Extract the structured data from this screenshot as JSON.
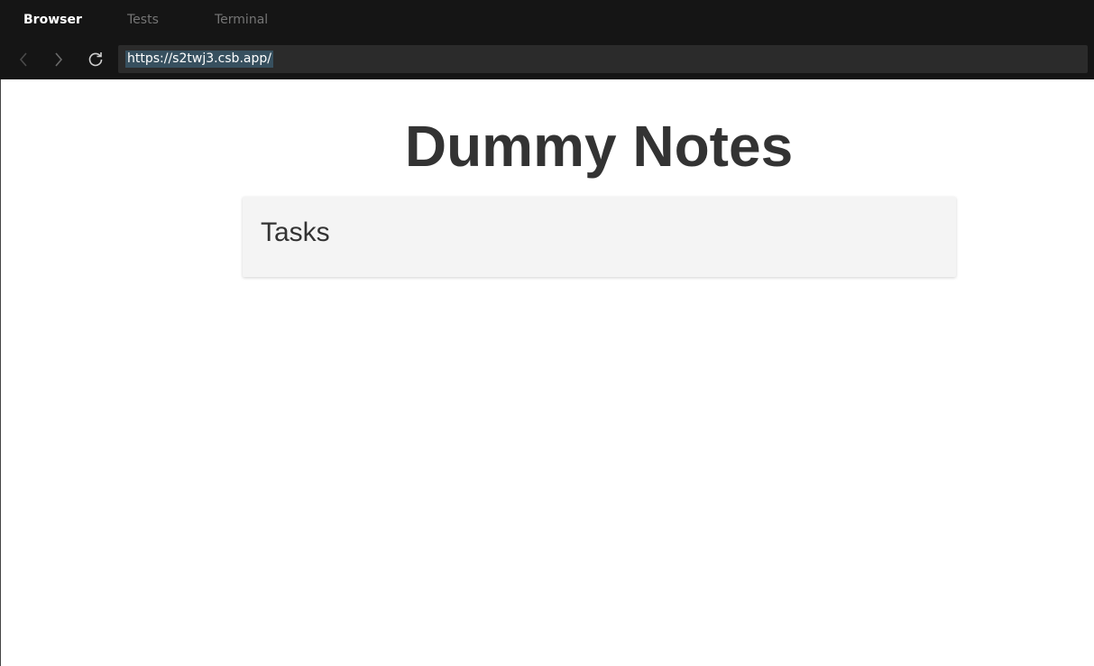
{
  "tabs": [
    {
      "label": "Browser",
      "active": true
    },
    {
      "label": "Tests",
      "active": false
    },
    {
      "label": "Terminal",
      "active": false
    }
  ],
  "nav": {
    "back_icon": "chevron-left-icon",
    "forward_icon": "chevron-right-icon",
    "refresh_icon": "refresh-icon"
  },
  "address_bar": {
    "url": "https://s2twj3.csb.app/"
  },
  "page": {
    "title": "Dummy Notes",
    "card": {
      "title": "Tasks"
    }
  },
  "colors": {
    "chrome_background": "#151515",
    "url_field_background": "#2b2b2b",
    "url_selection": "#37505f",
    "text_dark": "#333333",
    "card_background": "#f4f4f4"
  }
}
